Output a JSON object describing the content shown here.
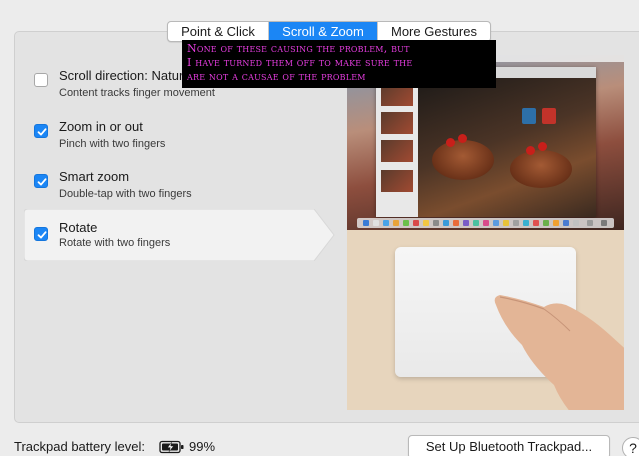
{
  "tabs": [
    {
      "label": "Point & Click",
      "selected": false
    },
    {
      "label": "Scroll & Zoom",
      "selected": true
    },
    {
      "label": "More Gestures",
      "selected": false
    }
  ],
  "options": [
    {
      "title": "Scroll direction: Natural",
      "subtitle": "Content tracks finger movement",
      "checked": false
    },
    {
      "title": "Zoom in or out",
      "subtitle": "Pinch with two fingers",
      "checked": true
    },
    {
      "title": "Smart zoom",
      "subtitle": "Double-tap with two fingers",
      "checked": true
    },
    {
      "title": "Rotate",
      "subtitle": "Rotate with two fingers",
      "checked": true
    }
  ],
  "annotation": {
    "lines": [
      "None of these causing the problem, but",
      "I have turned them off to make sure the",
      "are not a causae of the problem"
    ]
  },
  "bottom": {
    "battery_label": "Trackpad battery level:",
    "battery_percent": "99%",
    "setup_button": "Set Up Bluetooth Trackpad...",
    "help_button": "?"
  },
  "colors": {
    "accent": "#1b86f5",
    "annotation_text": "#e63de0",
    "annotation_bg": "#000000"
  }
}
